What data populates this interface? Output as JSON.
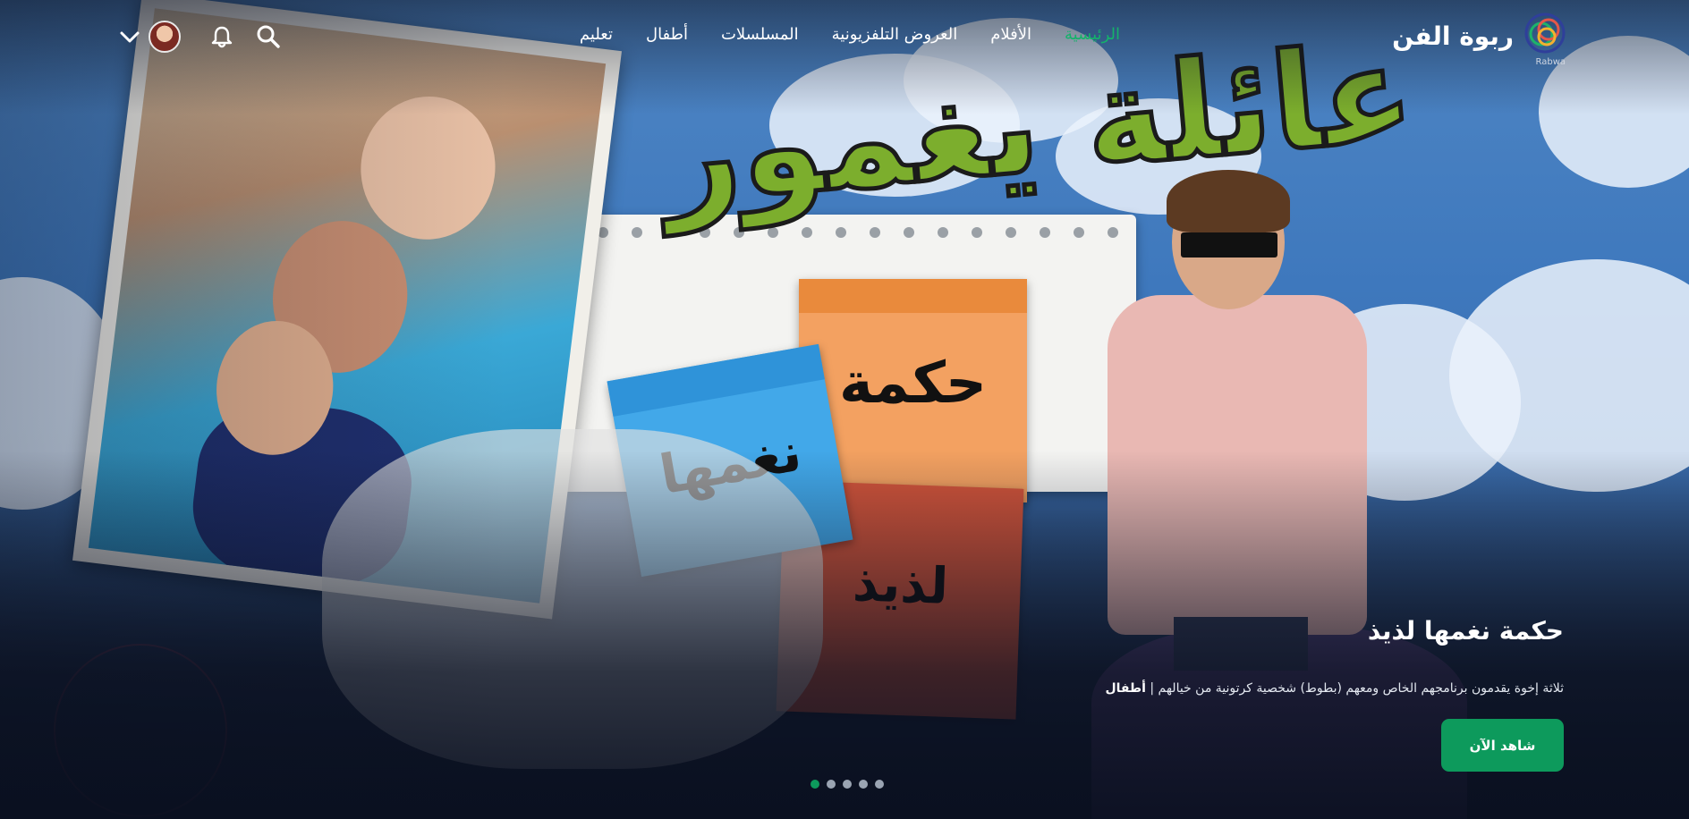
{
  "brand": {
    "name": "ربوة الفن",
    "sub": "Rabwa",
    "icon": "rabwa-logo-icon"
  },
  "nav": {
    "items": [
      {
        "label": "الرئيسية",
        "active": true
      },
      {
        "label": "الأفلام",
        "active": false
      },
      {
        "label": "العروض التلفزيونية",
        "active": false
      },
      {
        "label": "المسلسلات",
        "active": false
      },
      {
        "label": "أطفال",
        "active": false
      },
      {
        "label": "تعليم",
        "active": false
      }
    ]
  },
  "toolbar": {
    "search_icon": "search-icon",
    "notifications_icon": "bell-icon",
    "avatar": "user-avatar",
    "menu_icon": "chevron-down-icon"
  },
  "artwork": {
    "title": "عائلة يغمور",
    "note_orange": "حكمة",
    "note_blue": "نغمها",
    "note_red": "لذيذ"
  },
  "hero": {
    "title": "حكمة نغمها لذيذ",
    "description": "ثلاثة إخوة يقدمون برنامجهم الخاص ومعهم (بطوط) شخصية كرتونية من خيالهم |",
    "category": "أطفال",
    "watch_label": "شاهد الآن"
  },
  "carousel": {
    "total": 5,
    "active_index": 0
  },
  "colors": {
    "accent": "#0d9a5c",
    "active_nav": "#14b36a",
    "text": "#ffffff"
  }
}
